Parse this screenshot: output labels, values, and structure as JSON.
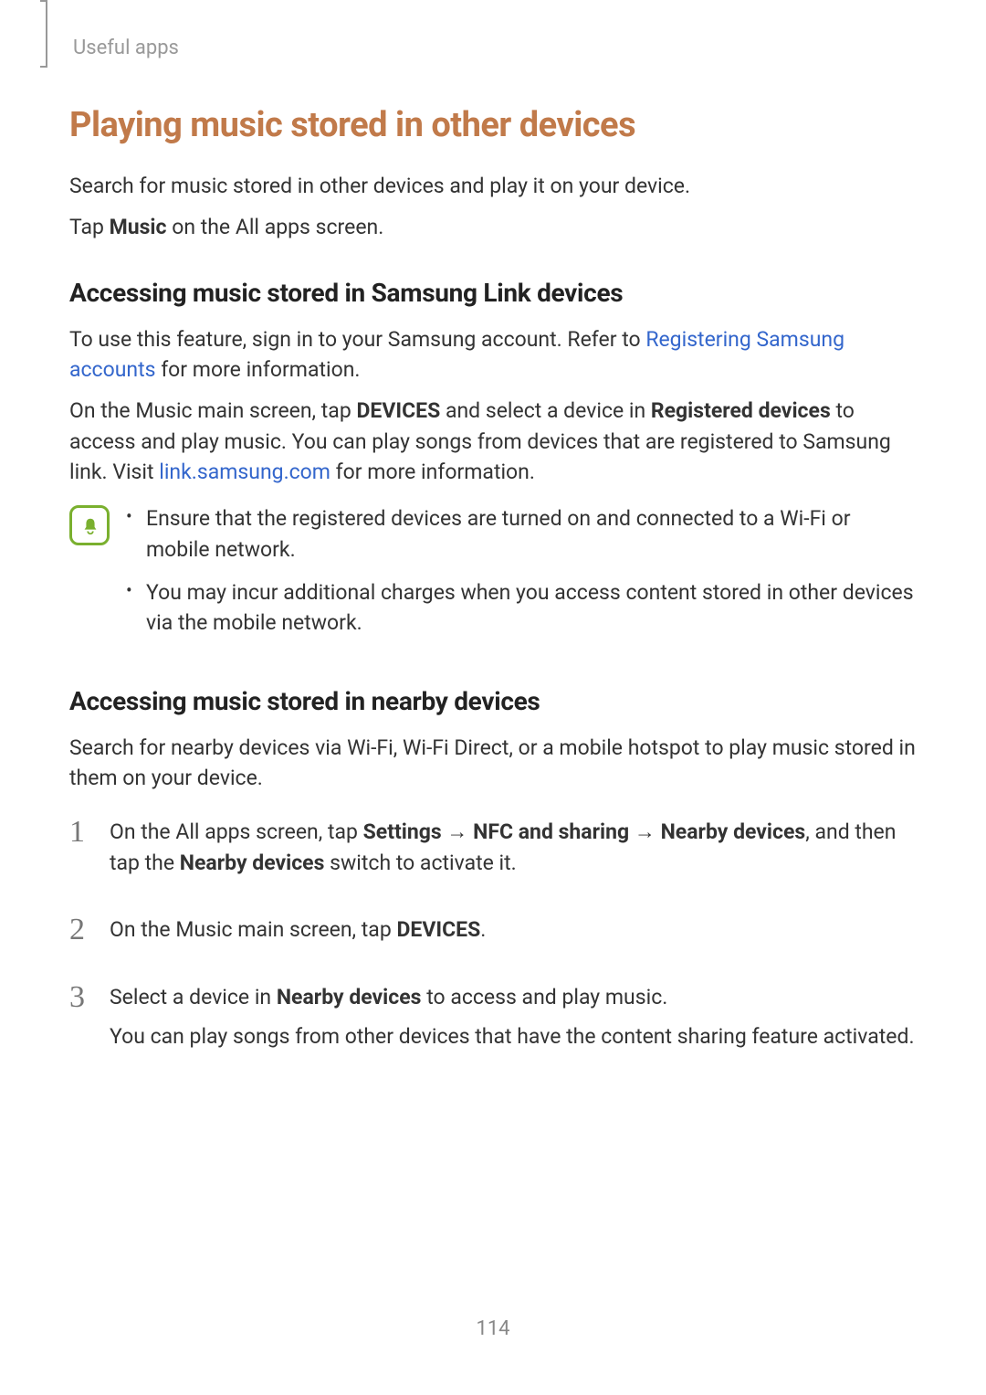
{
  "header": {
    "section": "Useful apps"
  },
  "h1": "Playing music stored in other devices",
  "intro1": "Search for music stored in other devices and play it on your device.",
  "intro2_pre": "Tap ",
  "intro2_bold": "Music",
  "intro2_post": " on the All apps screen.",
  "h2a": "Accessing music stored in Samsung Link devices",
  "p2a_pre": "To use this feature, sign in to your Samsung account. Refer to ",
  "p2a_link": "Registering Samsung accounts",
  "p2a_post": " for more information.",
  "p2b_pre": "On the Music main screen, tap ",
  "p2b_b1": "DEVICES",
  "p2b_mid": " and select a device in ",
  "p2b_b2": "Registered devices",
  "p2b_post": " to access and play music. You can play songs from devices that are registered to Samsung link. Visit ",
  "p2b_link": "link.samsung.com",
  "p2b_end": " for more information.",
  "notes": {
    "n1": "Ensure that the registered devices are turned on and connected to a Wi-Fi or mobile network.",
    "n2": "You may incur additional charges when you access content stored in other devices via the mobile network."
  },
  "h2b": "Accessing music stored in nearby devices",
  "p3": "Search for nearby devices via Wi-Fi, Wi-Fi Direct, or a mobile hotspot to play music stored in them on your device.",
  "steps": {
    "s1_pre": "On the All apps screen, tap ",
    "s1_b1": "Settings",
    "s1_arrow1": " → ",
    "s1_b2": "NFC and sharing",
    "s1_arrow2": " → ",
    "s1_b3": "Nearby devices",
    "s1_mid": ", and then tap the ",
    "s1_b4": "Nearby devices",
    "s1_post": " switch to activate it.",
    "s2_pre": "On the Music main screen, tap ",
    "s2_b1": "DEVICES",
    "s2_post": ".",
    "s3_pre": "Select a device in ",
    "s3_b1": "Nearby devices",
    "s3_post": " to access and play music.",
    "s3_line2": "You can play songs from other devices that have the content sharing feature activated."
  },
  "nums": {
    "n1": "1",
    "n2": "2",
    "n3": "3"
  },
  "page": "114"
}
